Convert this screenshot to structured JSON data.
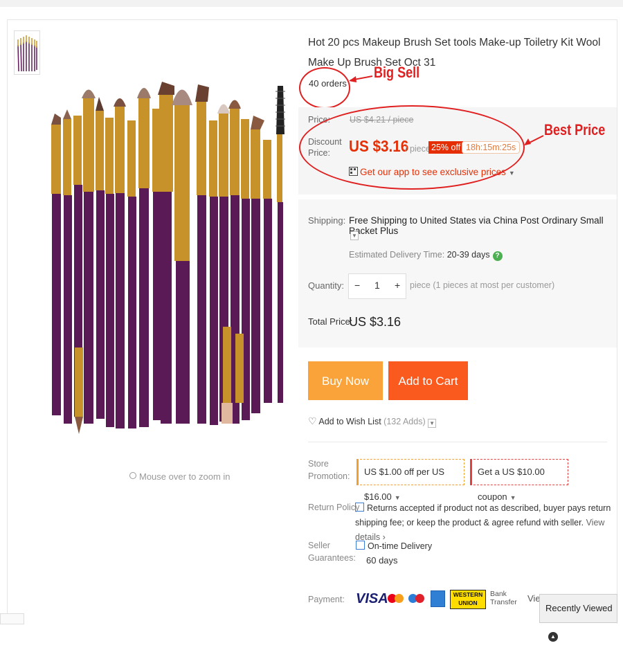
{
  "product": {
    "title": "Hot 20 pcs Makeup Brush Set tools Make-up Toiletry Kit Wool Make Up Brush Set Oct 31",
    "orders": "40 orders",
    "zoom_hint": "Mouse over to zoom in"
  },
  "annotations": {
    "big_sell": "Big Sell",
    "best_price": "Best Price"
  },
  "price": {
    "price_label": "Price:",
    "old_price": "US $4.21 / piece",
    "discount_label_1": "Discount",
    "discount_label_2": "Price:",
    "current_price": "US $3.16",
    "per_unit": "/ piece",
    "discount_badge": "25% off",
    "countdown": "18h:15m:25s",
    "app_promo": "Get our app to see exclusive prices"
  },
  "shipping": {
    "label": "Shipping:",
    "text": "Free Shipping to United States via China Post Ordinary Small Packet Plus",
    "est_label": "Estimated Delivery Time:",
    "est_value": "20-39 days"
  },
  "quantity": {
    "label": "Quantity:",
    "minus": "−",
    "value": "1",
    "plus": "+",
    "note": "piece (1 pieces at most per customer)"
  },
  "total": {
    "label": "Total Price:",
    "value": "US $3.16"
  },
  "buttons": {
    "buy_now": "Buy Now",
    "add_to_cart": "Add to Cart"
  },
  "wishlist": {
    "label": "Add to Wish List",
    "count": "(132 Adds)"
  },
  "promotion": {
    "label_1": "Store",
    "label_2": "Promotion:",
    "store_offer": "US $1.00 off per US $16.00",
    "coupon_prefix": "Get a",
    "coupon_value": "US $10.00",
    "coupon_suffix": "coupon"
  },
  "return_policy": {
    "label": "Return Policy",
    "text": "Returns accepted if product not as described, buyer pays return shipping fee; or keep the product & agree refund with seller.",
    "link": "View details"
  },
  "guarantees": {
    "label_1": "Seller",
    "label_2": "Guarantees:",
    "item": "On-time Delivery",
    "days": "60 days"
  },
  "payment": {
    "label": "Payment:",
    "visa": "VISA",
    "western_union_1": "WESTERN",
    "western_union_2": "UNION",
    "bank_1": "Bank",
    "bank_2": "Transfer",
    "view": "Vie"
  },
  "recently_viewed": "Recently Viewed",
  "colors": {
    "accent_red": "#e62e04",
    "buy_now": "#f9a33a",
    "add_to_cart": "#fa5a1e",
    "annotation": "#e02020",
    "brush_handle": "#5a1a55",
    "brush_ferrule": "#c8922a"
  }
}
